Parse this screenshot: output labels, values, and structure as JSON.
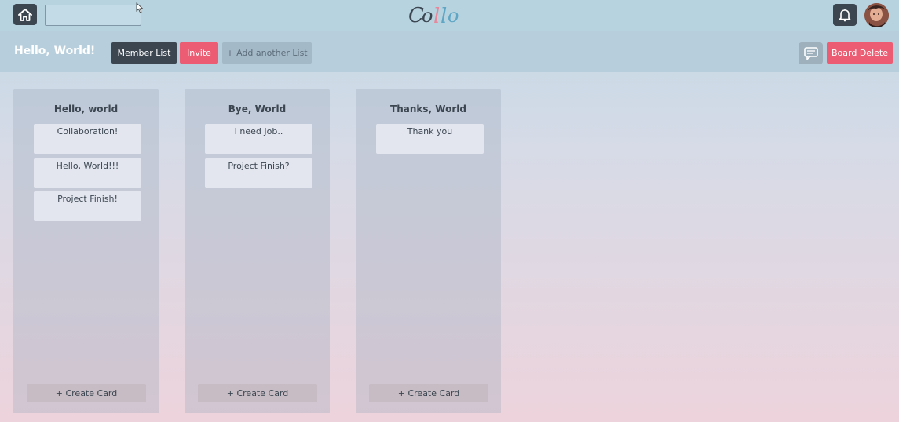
{
  "app": {
    "logo_text": "Collo",
    "colors": {
      "dark": "#3b4651",
      "accent": "#ec5d73",
      "logo_dark": "#3b4651",
      "logo_pink": "#e8869a",
      "logo_blue": "#5fa6c4"
    }
  },
  "topbar": {
    "home_icon": "home-icon",
    "search": {
      "value": "",
      "placeholder": ""
    },
    "bell_icon": "bell-icon",
    "avatar_icon": "user-avatar"
  },
  "board": {
    "title": "Hello, World!",
    "member_list_label": "Member List",
    "invite_label": "Invite",
    "add_list_label": "+ Add another List",
    "chat_icon": "chat-icon",
    "delete_label": "Board Delete"
  },
  "lists": [
    {
      "title": "Hello, world",
      "cards": [
        "Collaboration!",
        "Hello, World!!!",
        "Project Finish!"
      ],
      "create_label": "+ Create Card"
    },
    {
      "title": "Bye, World",
      "cards": [
        "I need Job..",
        "Project Finish?"
      ],
      "create_label": "+ Create Card"
    },
    {
      "title": "Thanks, World",
      "cards": [
        "Thank you"
      ],
      "create_label": "+ Create Card"
    }
  ]
}
